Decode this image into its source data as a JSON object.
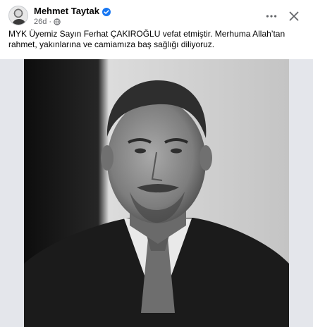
{
  "post": {
    "author": "Mehmet Taytak",
    "timestamp": "26d",
    "privacy_icon": "globe-icon",
    "verified_icon": "verified-badge-icon",
    "more_icon": "more-horizontal-icon",
    "close_icon": "close-icon",
    "caption": "MYK Üyemiz Sayın Ferhat ÇAKIROĞLU vefat etmiştir. Merhuma Allah’tan rahmet, yakınlarına ve camiamıza baş sağlığı diliyoruz.",
    "photo_style": "black-and-white portrait"
  },
  "colors": {
    "verified": "#1877f2",
    "secondary_text": "#65676b",
    "photo_backdrop": "#e4e6eb"
  }
}
